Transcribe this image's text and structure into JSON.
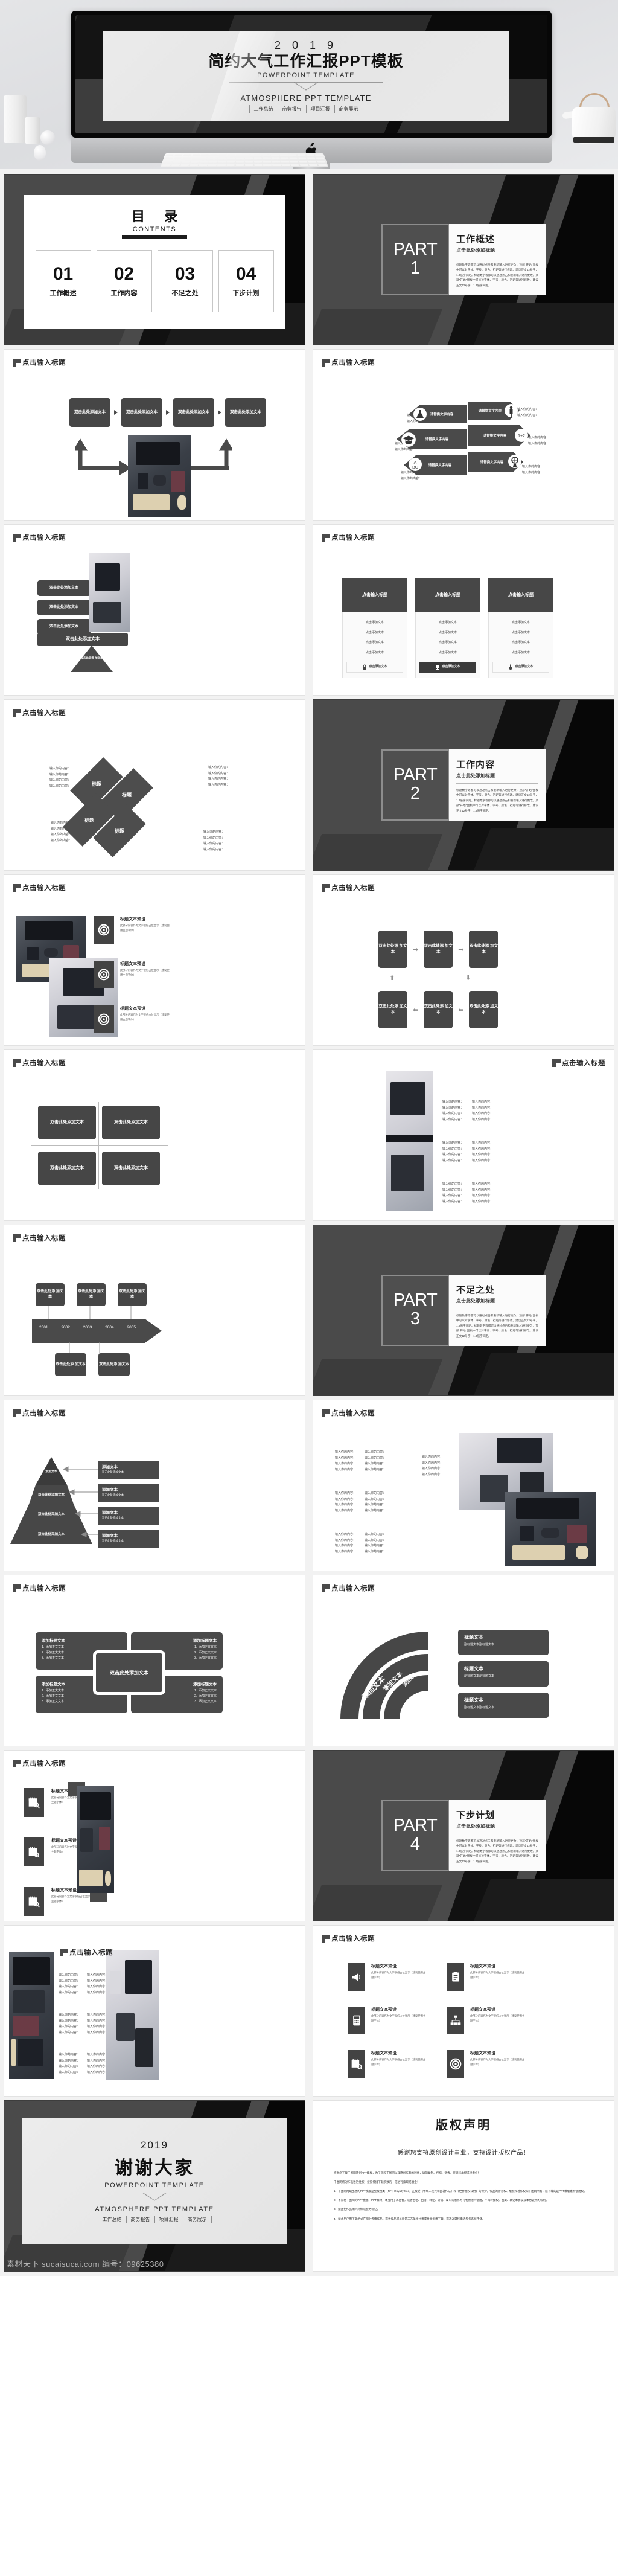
{
  "watermark": "素材天下 sucaisucai.com  编号：09625380",
  "hero": {
    "year": "2 0 1 9",
    "title": "简约大气工作汇报PPT模板",
    "subtitle": "POWERPOINT TEMPLATE",
    "subtitle2": "ATMOSPHERE PPT TEMPLATE",
    "tags": [
      "工作总结",
      "商务报告",
      "项目汇报",
      "商务展示"
    ]
  },
  "common": {
    "slide_title": "点击输入标题",
    "dbl_text": "双击此处添加文本",
    "dbl_text_2l": "双击此处添\n加文本",
    "add_text": "添加文本",
    "your_content": "输入你的内容：",
    "replace_text": "请替换文字内容",
    "click_add_text": "点击添加文本",
    "heading_preset": "标题文本预设",
    "preset_body": "此部分内容作为文字很低占位显示（建议使用主题字体）",
    "title_text": "标题文本",
    "sub_title_text": "副标题文本副标题文本",
    "add_title_text": "添加标题文本",
    "add_body_text": "添加正文文本",
    "biaoti": "标题"
  },
  "toc": {
    "heading": "目  录",
    "heading_en": "CONTENTS",
    "items": [
      {
        "num": "01",
        "label": "工作概述"
      },
      {
        "num": "02",
        "label": "工作内容"
      },
      {
        "num": "03",
        "label": "不足之处"
      },
      {
        "num": "04",
        "label": "下步计划"
      }
    ]
  },
  "parts": [
    {
      "word": "PART",
      "num": "1",
      "title": "工作概述",
      "subtitle": "点击此处添加标题",
      "body": "标题数字等都可以通过点击和重新输入进行更改，顶部“开始”面板中可以对字体、字号、颜色、行距等进行修改。建议正文12号字，1.3倍字间距。标题数字等都可以通过点击和重新输入进行更改，顶部“开始”面板中可以对字体、字号、颜色、行距等进行修改。建议正文12号字，1.3倍字间距。"
    },
    {
      "word": "PART",
      "num": "2",
      "title": "工作内容",
      "subtitle": "点击此处添加标题",
      "body": "标题数字等都可以通过点击和重新输入进行更改，顶部“开始”面板中可以对字体、字号、颜色、行距等进行修改。建议正文12号字，1.3倍字间距。标题数字等都可以通过点击和重新输入进行更改，顶部“开始”面板中可以对字体、字号、颜色、行距等进行修改。建议正文12号字，1.3倍字间距。"
    },
    {
      "word": "PART",
      "num": "3",
      "title": "不足之处",
      "subtitle": "点击此处添加标题",
      "body": "标题数字等都可以通过点击和重新输入进行更改，顶部“开始”面板中可以对字体、字号、颜色、行距等进行修改。建议正文12号字，1.3倍字间距。标题数字等都可以通过点击和重新输入进行更改，顶部“开始”面板中可以对字体、字号、颜色、行距等进行修改。建议正文12号字，1.3倍字间距。"
    },
    {
      "word": "PART",
      "num": "4",
      "title": "下步计划",
      "subtitle": "点击此处添加标题",
      "body": "标题数字等都可以通过点击和重新输入进行更改，顶部“开始”面板中可以对字体、字号、颜色、行距等进行修改。建议正文12号字，1.3倍字间距。标题数字等都可以通过点击和重新输入进行更改，顶部“开始”面板中可以对字体、字号、颜色、行距等进行修改。建议正文12号字，1.3倍字间距。"
    }
  ],
  "timeline": {
    "years": [
      "2001",
      "2002",
      "2003",
      "2004",
      "2005"
    ]
  },
  "thanks": {
    "year": "2019",
    "title": "谢谢大家",
    "subtitle": "POWERPOINT TEMPLATE",
    "subtitle2": "ATMOSPHERE PPT TEMPLATE",
    "tags": [
      "工作总结",
      "商务报告",
      "项目汇报",
      "商务展示"
    ]
  },
  "copyright": {
    "heading": "版权声明",
    "lead": "感谢您支持原创设计事业，支持设计版权产品！",
    "paragraphs": [
      "感谢您下载千图网原创PPT模板，为了您和千图网以及原创作者的利益，请勿复制、传播、销售，否则将承担法律责任！",
      "千图网将对作品进行维权，按照传播下载次数的十倍进行索取赔偿金！",
      "1、千图网网站出售的PPT模版是免版税类（RF：Royalty-free）正版受《中华人民共和国著作法》和《世界版权公约》的保护，作品的所有权、版权和著作权归千图网所有，您下载的是PPT模版素材使用权。",
      "2、不得将千图网的PPT模版、PPT素材，本身用于再出售，或者出租、出借、转让、分销、发布或者作为礼物供他人使用，不得转授权、出卖、转让本协议或本协议中的权利。",
      "3、禁止把作品纳入商标或服务标记。",
      "4、禁止用户用下载格式在网上传播作品，或者作品可以让第三方单独付费或共享免费下载、或通过转移电话服务系统传播。"
    ]
  }
}
